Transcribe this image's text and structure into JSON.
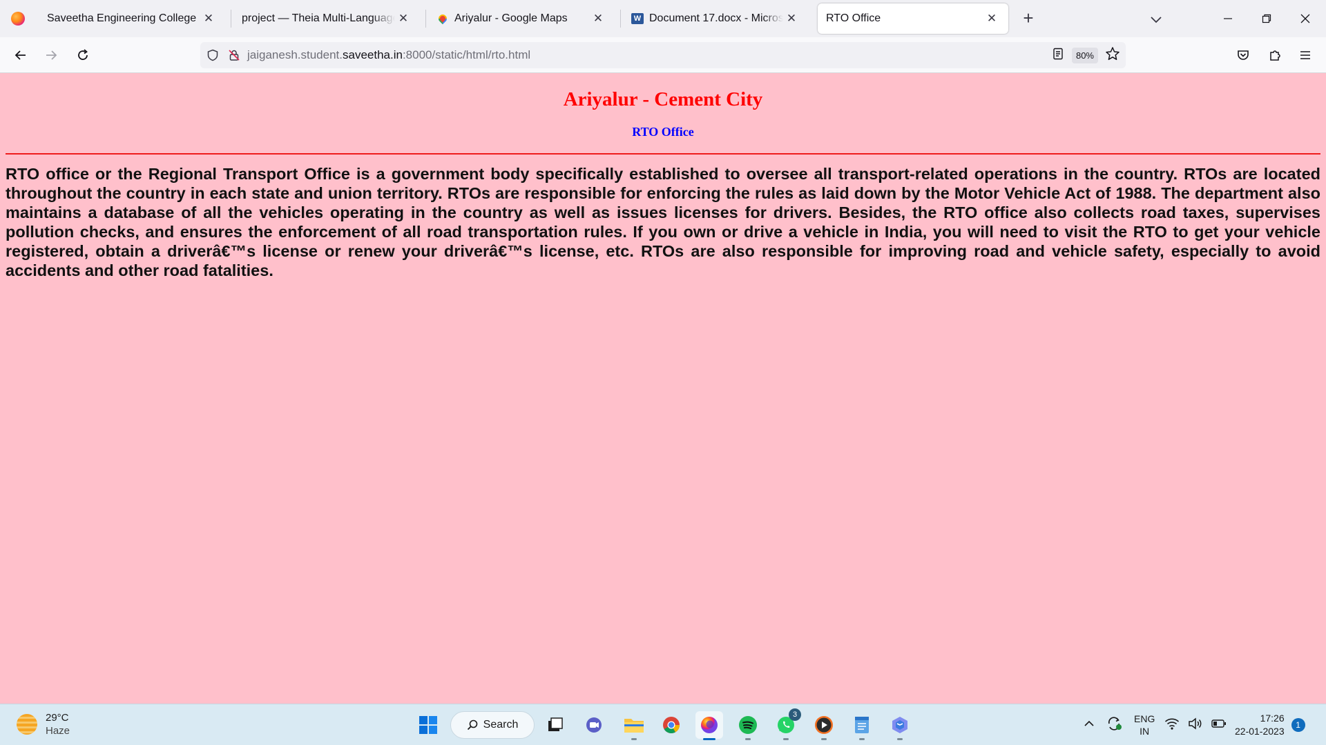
{
  "browser": {
    "tabs": [
      {
        "title": "Saveetha Engineering College"
      },
      {
        "title": "project — Theia Multi-Language Ex"
      },
      {
        "title": "Ariyalur - Google Maps"
      },
      {
        "title": "Document 17.docx - Microsoft W"
      },
      {
        "title": "RTO Office"
      }
    ],
    "url_prefix": "jaiganesh.student.",
    "url_domain": "saveetha.in",
    "url_suffix": ":8000/static/html/rto.html",
    "zoom": "80%",
    "word_icon_letter": "W"
  },
  "page": {
    "heading": "Ariyalur - Cement City",
    "subheading": "RTO Office",
    "paragraph": "RTO office or the Regional Transport Office is a government body specifically established to oversee all transport-related operations in the country. RTOs are located throughout the country in each state and union territory. RTOs are responsible for enforcing the rules as laid down by the Motor Vehicle Act of 1988. The department also maintains a database of all the vehicles operating in the country as well as issues licenses for drivers. Besides, the RTO office also collects road taxes, supervises pollution checks, and ensures the enforcement of all road transportation rules. If you own or drive a vehicle in India, you will need to visit the RTO to get your vehicle registered, obtain a driverâ€™s license or renew your driverâ€™s license, etc. RTOs are also responsible for improving road and vehicle safety, especially to avoid accidents and other road fatalities.",
    "heading_color": "#ff0000",
    "subheading_color": "#0000ff",
    "background_color": "#ffc0cb"
  },
  "taskbar": {
    "weather_temp": "29°C",
    "weather_desc": "Haze",
    "search_label": "Search",
    "whatsapp_badge": "3",
    "lang_line1": "ENG",
    "lang_line2": "IN",
    "time": "17:26",
    "date": "22-01-2023",
    "notification_count": "1"
  }
}
